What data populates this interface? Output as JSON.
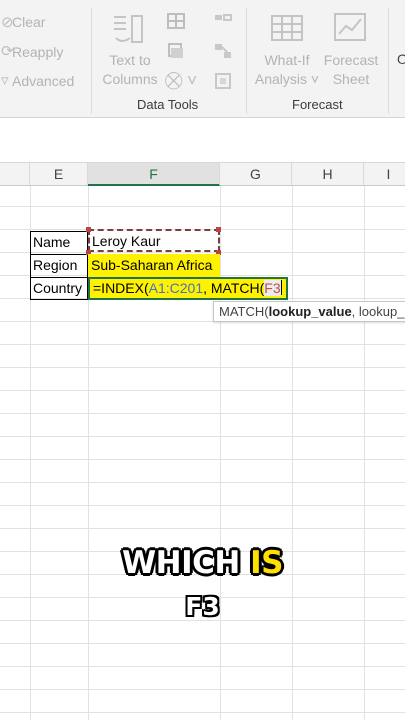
{
  "ribbon": {
    "sort_filter": {
      "clear": "Clear",
      "reapply": "Reapply",
      "advanced": "Advanced"
    },
    "data_tools": {
      "text_to_columns_line1": "Text to",
      "text_to_columns_line2": "Columns",
      "group_label": "Data Tools"
    },
    "forecast": {
      "what_if_line1": "What-If",
      "what_if_line2": "Analysis",
      "forecast_sheet_line1": "Forecast",
      "forecast_sheet_line2": "Sheet",
      "group_label": "Forecast"
    },
    "outline_partial": "O"
  },
  "columns": [
    "E",
    "F",
    "G",
    "H",
    "I"
  ],
  "active_column": "F",
  "cells": {
    "labels": [
      "Name",
      "Region",
      "Country"
    ],
    "name_value": "Leroy Kaur",
    "region_value": "Sub-Saharan Africa"
  },
  "formula": {
    "prefix": "=INDEX(",
    "range": "A1:C201",
    "mid": ", MATCH(",
    "ref": "F3"
  },
  "tooltip": {
    "func": "MATCH(",
    "arg_bold": "lookup_value",
    "rest": ", lookup_"
  },
  "caption": {
    "word1": "WHICH",
    "word2": "IS",
    "line2": "F3"
  },
  "colors": {
    "highlight": "#fff200",
    "excel_green": "#217346",
    "caption_yellow": "#ffe100"
  }
}
